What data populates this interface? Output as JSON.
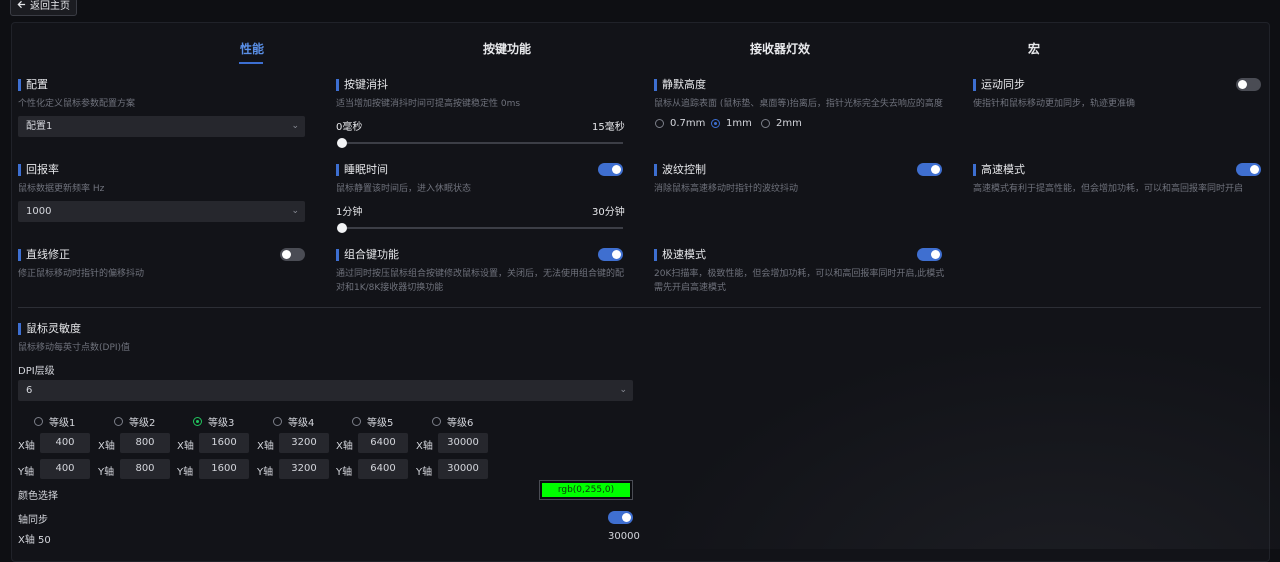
{
  "back_button": {
    "label": "返回主页",
    "icon": "arrow-left-icon"
  },
  "tabs": [
    {
      "label": "性能",
      "active": true
    },
    {
      "label": "按键功能"
    },
    {
      "label": "接收器灯效"
    },
    {
      "label": "宏"
    }
  ],
  "config": {
    "title": "配置",
    "desc": "个性化定义鼠标参数配置方案",
    "selected": "配置1"
  },
  "debounce": {
    "title": "按键消抖",
    "desc": "适当增加按键消抖时间可提高按键稳定性 0ms",
    "min_label": "0毫秒",
    "max_label": "15毫秒",
    "value": 0
  },
  "lod": {
    "title": "静默高度",
    "desc": "鼠标从追踪表面 (鼠标垫、桌面等)抬离后，指针光标完全失去响应的高度",
    "options": [
      "0.7mm",
      "1mm",
      "2mm"
    ],
    "selected": "1mm"
  },
  "motion_sync": {
    "title": "运动同步",
    "desc": "使指针和鼠标移动更加同步，轨迹更准确",
    "enabled": false
  },
  "polling": {
    "title": "回报率",
    "desc": "鼠标数据更新频率 Hz",
    "selected": "1000"
  },
  "sleep": {
    "title": "睡眠时间",
    "desc": "鼠标静置该时间后，进入休眠状态",
    "min_label": "1分钟",
    "max_label": "30分钟",
    "enabled": true,
    "value": 1
  },
  "ripple": {
    "title": "波纹控制",
    "desc": "消除鼠标高速移动时指针的波纹抖动",
    "enabled": true
  },
  "high_speed": {
    "title": "高速模式",
    "desc": "高速模式有利于提高性能，但会增加功耗，可以和高回报率同时开启",
    "enabled": true
  },
  "angle_snap": {
    "title": "直线修正",
    "desc": "修正鼠标移动时指针的偏移抖动",
    "enabled": false
  },
  "combo_keys": {
    "title": "组合键功能",
    "desc_line1": "通过同时按压鼠标组合按键修改鼠标设置，关闭后，无法使用组合键的配",
    "desc_line2": "对和1K/8K接收器切换功能",
    "enabled": true
  },
  "turbo": {
    "title": "极速模式",
    "desc_line1": "20K扫描率，极致性能，但会增加功耗，可以和高回报率同时开启,此模式",
    "desc_line2": "需先开启高速模式",
    "enabled": true
  },
  "dpi": {
    "title": "鼠标灵敏度",
    "desc": "鼠标移动每英寸点数(DPI)值",
    "level_label": "DPI层级",
    "level_selected": "6",
    "levels": [
      {
        "label": "等级1",
        "x": "400",
        "y": "400"
      },
      {
        "label": "等级2",
        "x": "800",
        "y": "800"
      },
      {
        "label": "等级3",
        "x": "1600",
        "y": "1600",
        "selected": true
      },
      {
        "label": "等级4",
        "x": "3200",
        "y": "3200"
      },
      {
        "label": "等级5",
        "x": "6400",
        "y": "6400"
      },
      {
        "label": "等级6",
        "x": "30000",
        "y": "30000"
      }
    ],
    "x_axis_label": "X轴",
    "y_axis_label": "Y轴",
    "color_label": "颜色选择",
    "color_value": "rgb(0,255,0)",
    "color_hex": "#00ff00",
    "axis_sync_label": "轴同步",
    "axis_sync_enabled": true,
    "x_slider_label": "X轴 50",
    "x_slider_max": "30000"
  },
  "colors": {
    "accent": "#3d6fd1",
    "toggle_on": "#3f6fd0",
    "selected_level": "#22c55e"
  }
}
